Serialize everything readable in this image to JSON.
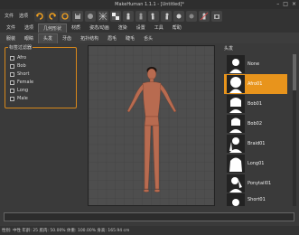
{
  "window": {
    "title": "MakeHuman 1.1.1 - [Untitled]*",
    "min_glyph": "–",
    "max_glyph": "□",
    "close_glyph": "×"
  },
  "menu": [
    "文件",
    "选项",
    "几何形状",
    "材质",
    "姿态/动画",
    "渲染",
    "设置",
    "工具",
    "帮助"
  ],
  "toolbar_icons": [
    "undo-icon",
    "redo-icon",
    "reset-icon",
    "save-icon",
    "smooth-icon",
    "wireframe-icon",
    "background-icon",
    "front-view-icon",
    "back-view-icon",
    "left-view-icon",
    "right-view-icon",
    "top-view-icon",
    "bottom-view-icon",
    "reset-camera-icon",
    "screenshot-icon"
  ],
  "main_tabs": [
    {
      "label": "文件"
    },
    {
      "label": "选项"
    },
    {
      "label": "几何形状",
      "active": true
    },
    {
      "label": "材质"
    },
    {
      "label": "姿态/动画"
    },
    {
      "label": "渲染"
    },
    {
      "label": "设置"
    },
    {
      "label": "工具"
    },
    {
      "label": "帮助"
    }
  ],
  "sub_tabs": [
    {
      "label": "服装"
    },
    {
      "label": "眼睛"
    },
    {
      "label": "头发",
      "active": true
    },
    {
      "label": "牙齿"
    },
    {
      "label": "拓扑结构"
    },
    {
      "label": "眉毛"
    },
    {
      "label": "睫毛"
    },
    {
      "label": "舌头"
    }
  ],
  "filter": {
    "title": "标签过滤器",
    "items": [
      "Afro",
      "Bob",
      "Short",
      "Female",
      "Long",
      "Male"
    ]
  },
  "hair": {
    "title": "头发",
    "items": [
      {
        "name": "None"
      },
      {
        "name": "Afro01",
        "selected": true
      },
      {
        "name": "Bob01"
      },
      {
        "name": "Bob02"
      },
      {
        "name": "Braid01"
      },
      {
        "name": "Long01"
      },
      {
        "name": "Ponytail01"
      },
      {
        "name": "Short01"
      }
    ]
  },
  "status": "性别: 中性 年龄: 25 肌肉: 50.00% 体重: 100.00% 身高: 165.94 cm",
  "colors": {
    "accent": "#e8941c",
    "background": "#3a3a3a",
    "viewport": "#4e4e4e"
  }
}
